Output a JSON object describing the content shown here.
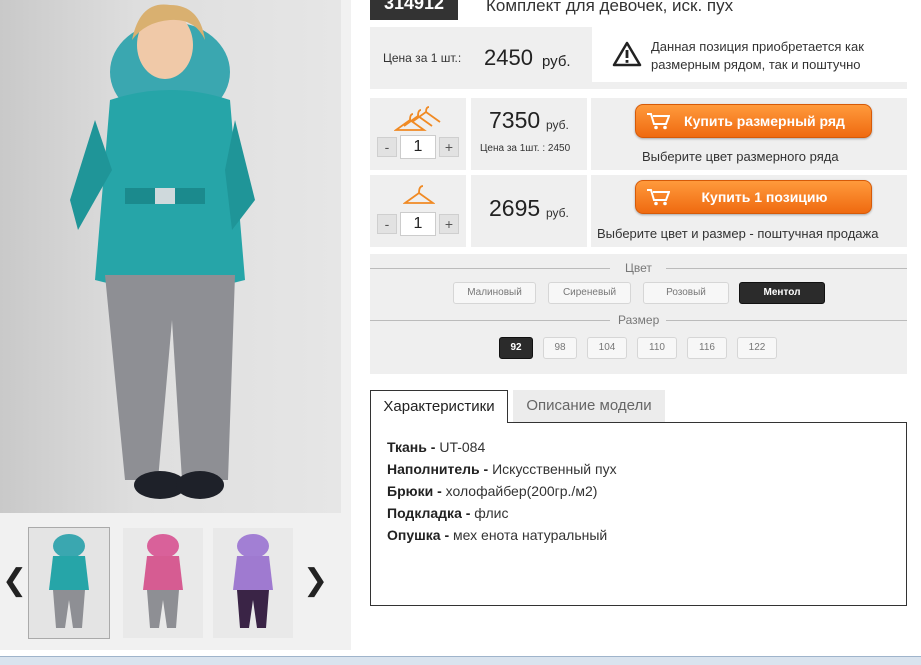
{
  "product": {
    "article": "314912",
    "title": "Комплект для девочек, иск. пух"
  },
  "price": {
    "label": "Цена за 1 шт.:",
    "value": "2450",
    "unit": "руб."
  },
  "notice": {
    "line1": "Данная позиция приобретается как",
    "line2": "размерным рядом, так и поштучно"
  },
  "size_row": {
    "quantity": "1",
    "price": "7350",
    "unit": "руб.",
    "per_unit": "Цена за 1шт. : 2450",
    "button": "Купить размерный ряд",
    "hint": "Выберите цвет размерного ряда"
  },
  "single": {
    "quantity": "1",
    "price": "2695",
    "unit": "руб.",
    "button": "Купить 1 позицию",
    "hint": "Выберите цвет и размер - поштучная продажа"
  },
  "stepper": {
    "minus": "-",
    "plus": "+"
  },
  "colors": {
    "title": "Цвет",
    "options": [
      "Малиновый",
      "Сиреневый",
      "Розовый",
      "Ментол"
    ],
    "selected": "Ментол"
  },
  "sizes": {
    "title": "Размер",
    "options": [
      "92",
      "98",
      "104",
      "110",
      "116",
      "122"
    ],
    "selected": "92"
  },
  "tabs": [
    "Характеристики",
    "Описание модели"
  ],
  "specs": [
    {
      "label": "Ткань -",
      "value": "UT-084"
    },
    {
      "label": "Наполнитель -",
      "value": "Искусственный пух"
    },
    {
      "label": "Брюки -",
      "value": "холофайбер(200гр./м2)"
    },
    {
      "label": "Подкладка -",
      "value": "флис"
    },
    {
      "label": "Опушка -",
      "value": "мех енота натуральный"
    }
  ],
  "gallery": {
    "prev": "‹",
    "next": "›"
  },
  "accent_color": "#f27a1a"
}
